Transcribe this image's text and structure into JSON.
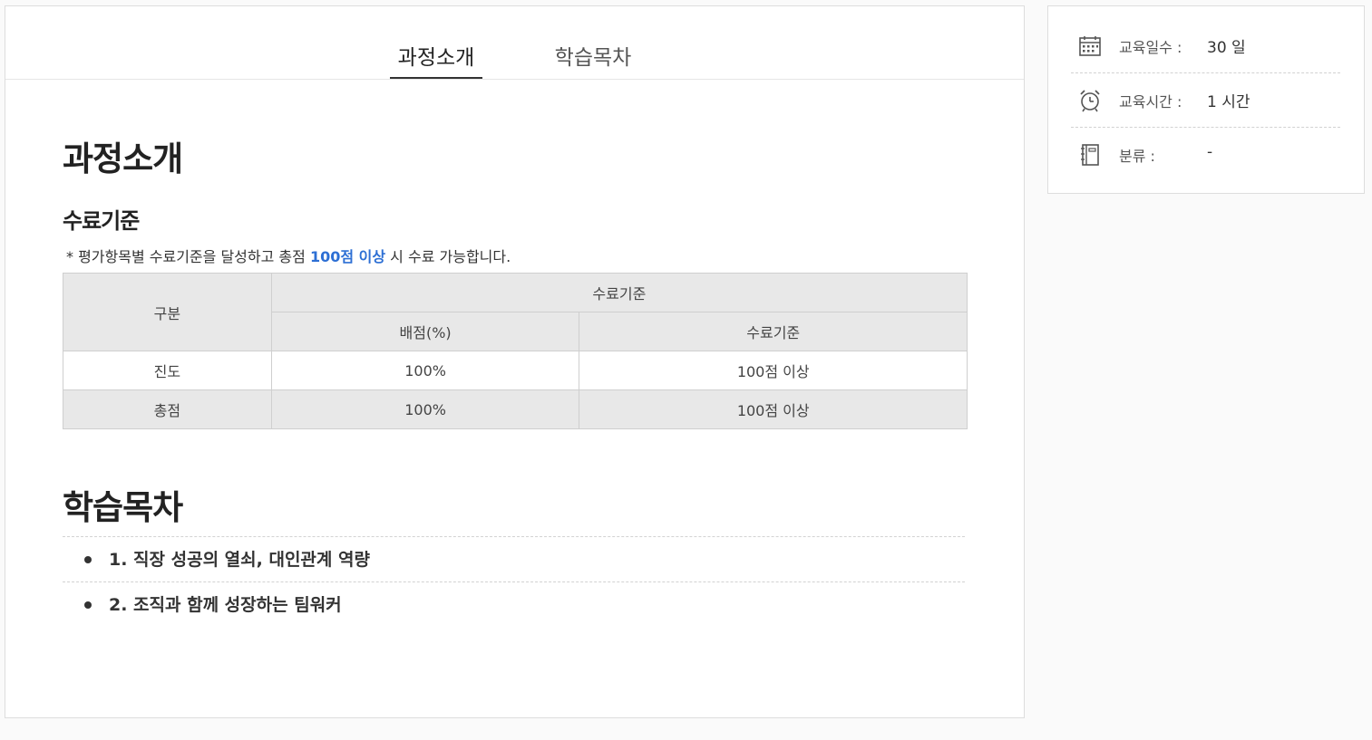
{
  "tabs": [
    {
      "label": "과정소개",
      "active": true
    },
    {
      "label": "학습목차",
      "active": false
    }
  ],
  "intro": {
    "title": "과정소개",
    "criteria_title": "수료기준",
    "notice_prefix": "* 평가항목별 수료기준을 달성하고 총점 ",
    "notice_highlight": "100점 이상",
    "notice_suffix": " 시 수료 가능합니다.",
    "table": {
      "col_category": "구분",
      "col_group": "수료기준",
      "col_weight": "배점(%)",
      "col_criteria": "수료기준",
      "rows": [
        {
          "category": "진도",
          "weight": "100%",
          "criteria": "100점 이상"
        },
        {
          "category": "총점",
          "weight": "100%",
          "criteria": "100점 이상"
        }
      ]
    }
  },
  "toc": {
    "title": "학습목차",
    "items": [
      "1. 직장 성공의 열쇠, 대인관계 역량",
      "2. 조직과 함께 성장하는 팀워커"
    ]
  },
  "info": {
    "days_label": "교육일수 :",
    "days_value": "30 일",
    "hours_label": "교육시간 :",
    "hours_value": "1 시간",
    "category_label": "분류 :",
    "category_value": "-",
    "icons": [
      "calendar-icon",
      "alarm-clock-icon",
      "notebook-icon"
    ]
  },
  "colors": {
    "highlight": "#2d6fd4",
    "table_header_bg": "#e8e8e8"
  }
}
